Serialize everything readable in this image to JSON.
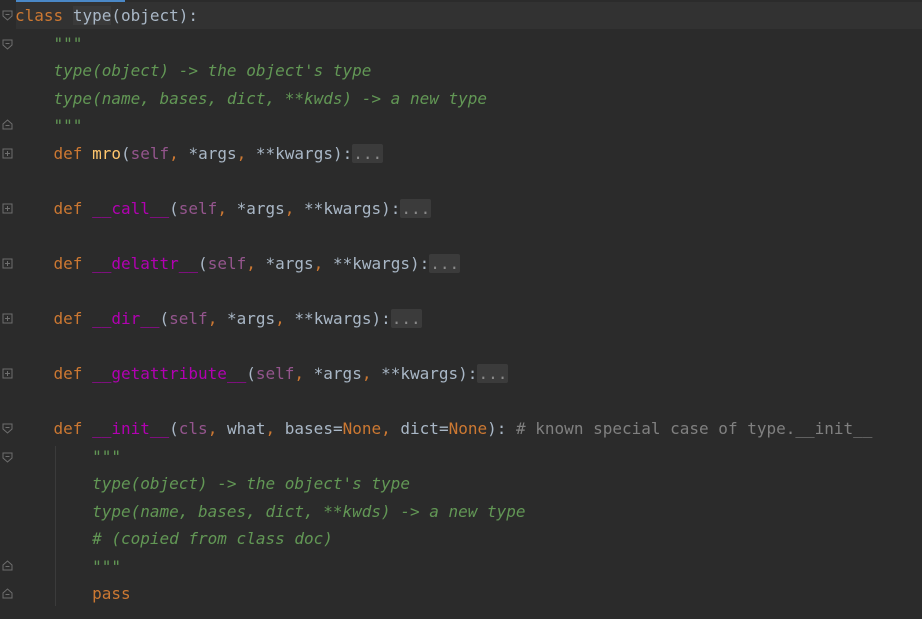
{
  "editor": {
    "language": "python",
    "lines": {
      "l1": {
        "kw": "class",
        "name": "type",
        "rest": "(object):"
      },
      "l2": {
        "doc": "\"\"\""
      },
      "l3": {
        "doc": "type(object) -> the object's type"
      },
      "l4": {
        "doc": "type(name, bases, dict, **kwds) -> a new type"
      },
      "l5": {
        "doc": "\"\"\""
      },
      "l6": {
        "kw": "def",
        "name": "mro",
        "self": "self",
        "args": "*args",
        "kwargs": "**kwargs",
        "close": "):",
        "fold": "..."
      },
      "l7": {
        "kw": "def",
        "name": "__call__",
        "self": "self",
        "args": "*args",
        "kwargs": "**kwargs",
        "close": "):",
        "fold": "..."
      },
      "l8": {
        "kw": "def",
        "name": "__delattr__",
        "self": "self",
        "args": "*args",
        "kwargs": "**kwargs",
        "close": "):",
        "fold": "..."
      },
      "l9": {
        "kw": "def",
        "name": "__dir__",
        "self": "self",
        "args": "*args",
        "kwargs": "**kwargs",
        "close": "):",
        "fold": "..."
      },
      "l10": {
        "kw": "def",
        "name": "__getattribute__",
        "self": "self",
        "args": "*args",
        "kwargs": "**kwargs",
        "close": "):",
        "fold": "..."
      },
      "l11": {
        "kw": "def",
        "name": "__init__",
        "cls": "cls",
        "what": "what",
        "bases": "bases",
        "none1": "None",
        "dict": "dict",
        "none2": "None",
        "close": "):",
        "comment": "# known special case of type.__init__"
      },
      "l12": {
        "doc": "\"\"\""
      },
      "l13": {
        "doc": "type(object) -> the object's type"
      },
      "l14": {
        "doc": "type(name, bases, dict, **kwds) -> a new type"
      },
      "l15": {
        "doc": "# (copied from class doc)"
      },
      "l16": {
        "doc": "\"\"\""
      },
      "l17": {
        "kw": "pass"
      }
    }
  },
  "colors": {
    "background": "#2b2b2b",
    "keyword": "#cc7832",
    "function": "#ffc66d",
    "dunder": "#b200b2",
    "self_param": "#94558d",
    "docstring": "#629755",
    "comment": "#808080",
    "text": "#a9b7c6"
  }
}
